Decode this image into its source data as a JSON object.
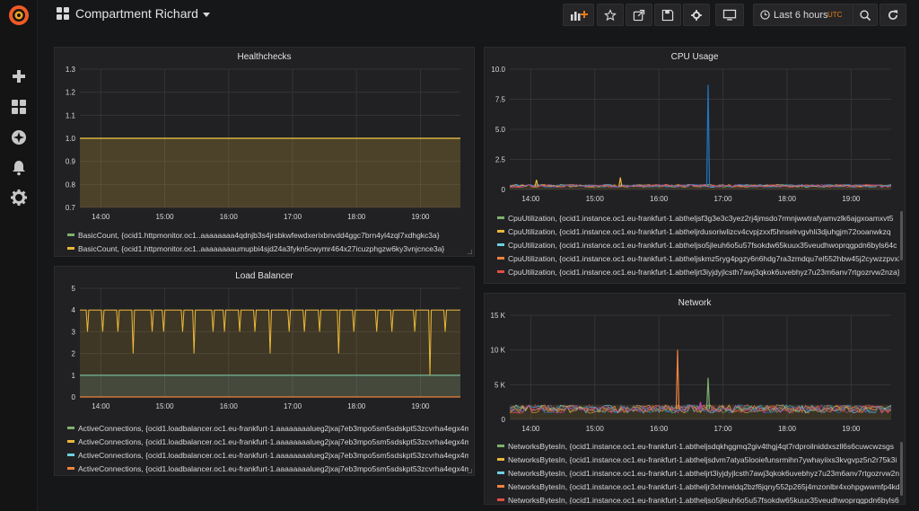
{
  "dashboard": {
    "title": "Compartment Richard"
  },
  "sidebar": {
    "items": [
      {
        "name": "create",
        "icon": "plus-icon"
      },
      {
        "name": "dashboards",
        "icon": "apps-grid-icon"
      },
      {
        "name": "explore",
        "icon": "compass-icon"
      },
      {
        "name": "alerting",
        "icon": "bell-icon"
      },
      {
        "name": "configuration",
        "icon": "gear-icon"
      }
    ]
  },
  "toolbar": {
    "time_range": "Last 6 hours",
    "timezone": "UTC",
    "buttons": [
      "add-panel-icon",
      "star-icon",
      "share-icon",
      "save-icon",
      "settings-gear-icon",
      "tv-mode-icon",
      "zoom-out-icon",
      "refresh-icon"
    ]
  },
  "colors": {
    "accent": "#eb7b18",
    "green": "#7eb26d",
    "yellow": "#eab839",
    "cyan": "#6ed0e0",
    "orange": "#ef843c",
    "red": "#e24d42",
    "blue": "#1f78c1",
    "purple": "#ba43a9"
  },
  "panels": {
    "healthchecks": {
      "title": "Healthchecks",
      "legend": [
        {
          "color": "#7eb26d",
          "text": "BasicCount, {ocid1.httpmonitor.oc1..aaaaaaaa4qdnjb3s4jrsbkwfewdxerixbnvdd4ggc7brn4yl4zql7xdhgkc3a}"
        },
        {
          "color": "#eab839",
          "text": "BasicCount, {ocid1.httpmonitor.oc1..aaaaaaaaumupbi4sjd24a3fykn5cwymr464x27icuzphgzw6ky3vnjcnce3a}"
        }
      ]
    },
    "load_balancer": {
      "title": "Load Balancer",
      "legend": [
        {
          "color": "#7eb26d",
          "text": "ActiveConnections, {ocid1.loadbalancer.oc1.eu-frankfurt-1.aaaaaaaalueg2jxaj7eb3mpo5sm5sdskpt53zcvrha4egx4m"
        },
        {
          "color": "#eab839",
          "text": "ActiveConnections, {ocid1.loadbalancer.oc1.eu-frankfurt-1.aaaaaaaalueg2jxaj7eb3mpo5sm5sdskpt53zcvrha4egx4m"
        },
        {
          "color": "#6ed0e0",
          "text": "ActiveConnections, {ocid1.loadbalancer.oc1.eu-frankfurt-1.aaaaaaaalueg2jxaj7eb3mpo5sm5sdskpt53zcvrha4egx4m"
        },
        {
          "color": "#ef843c",
          "text": "ActiveConnections, {ocid1.loadbalancer.oc1.eu-frankfurt-1.aaaaaaaalueg2jxaj7eb3mpo5sm5sdskpt53zcvrha4egx4m"
        }
      ]
    },
    "cpu_usage": {
      "title": "CPU Usage",
      "legend": [
        {
          "color": "#7eb26d",
          "text": "CpuUtilization, {ocid1.instance.oc1.eu-frankfurt-1.abtheljsf3g3e3c3yez2rj4jmsdo7rmnjwwtrafyamvzlk6ajgxoamxvt5"
        },
        {
          "color": "#eab839",
          "text": "CpuUtilization, {ocid1.instance.oc1.eu-frankfurt-1.abtheljrdusoriwlizcv4cvpjzxxf5hnselrvgvhli3djuhgjm72ooanwkzq"
        },
        {
          "color": "#6ed0e0",
          "text": "CpuUtilization, {ocid1.instance.oc1.eu-frankfurt-1.abtheljso5jleuh6o5u57fsokdw65kuux35veudhwoprqgpdn6byls64c"
        },
        {
          "color": "#ef843c",
          "text": "CpuUtilization, {ocid1.instance.oc1.eu-frankfurt-1.abtheljskmz5ryg4pgzy6n6hdg7ra3zmdqu7el552hbw45j2cywzzpvx3"
        },
        {
          "color": "#e24d42",
          "text": "CpuUtilization, {ocid1.instance.oc1.eu-frankfurt-1.abtheljrt3iyjdyjlcsth7awj3qkok6uvebhyz7u23m6anv7rtgozrvw2nza}"
        }
      ]
    },
    "network": {
      "title": "Network",
      "legend": [
        {
          "color": "#7eb26d",
          "text": "NetworksBytesIn, {ocid1.instance.oc1.eu-frankfurt-1.abtheljsdqkhggmq2giv4thgj4qt7rdproilniddxszll6s6cuwcwzsgs"
        },
        {
          "color": "#eab839",
          "text": "NetworksBytesIn, {ocid1.instance.oc1.eu-frankfurt-1.abtheljsdvm7atya5looiefunsrmihn7ywhayiixs3kvgvpz5n2r75k3i"
        },
        {
          "color": "#6ed0e0",
          "text": "NetworksBytesIn, {ocid1.instance.oc1.eu-frankfurt-1.abtheljrt3iyjdyjlcsth7awj3qkok6uvebhyz7u23m6anv7rtgozrvw2n"
        },
        {
          "color": "#ef843c",
          "text": "NetworksBytesIn, {ocid1.instance.oc1.eu-frankfurt-1.abtheljr3xhmeldq2bzf6jqny552p265j4mzonlbr4xohpgwwmfp4kd"
        },
        {
          "color": "#e24d42",
          "text": "NetworksBytesIn, {ocid1.instance.oc1.eu-frankfurt-1.abtheljso5jleuh6o5u57fsokdw65kuux35veudhwoprqgpdn6byls6"
        }
      ]
    }
  },
  "chart_data": [
    {
      "id": "healthchecks",
      "type": "line",
      "title": "Healthchecks",
      "x_ticks": [
        "14:00",
        "15:00",
        "16:00",
        "17:00",
        "18:00",
        "19:00"
      ],
      "y_ticks": [
        "0.7",
        "0.8",
        "0.9",
        "1.0",
        "1.1",
        "1.2",
        "1.3"
      ],
      "ylim": [
        0.7,
        1.3
      ],
      "series": [
        {
          "name": "BasicCount, {ocid1.httpmonitor.oc1..aaaaaaaa4qdnjb3s4jrsbkwfewdxerixbnvdd4ggc7brn4yl4zql7xdhgkc3a}",
          "color": "#7eb26d",
          "values": [
            1.0,
            1.0
          ]
        },
        {
          "name": "BasicCount, {ocid1.httpmonitor.oc1..aaaaaaaaumupbi4sjd24a3fykn5cwymr464x27icuzphgzw6ky3vnjcnce3a}",
          "color": "#eab839",
          "values": [
            1.0,
            1.0
          ]
        }
      ]
    },
    {
      "id": "load_balancer",
      "type": "line",
      "title": "Load Balancer",
      "x_ticks": [
        "14:00",
        "15:00",
        "16:00",
        "17:00",
        "18:00",
        "19:00"
      ],
      "y_ticks": [
        "0",
        "1",
        "2",
        "3",
        "4",
        "5"
      ],
      "ylim": [
        0,
        5
      ],
      "series": [
        {
          "name": "ActiveConnections (green)",
          "color": "#7eb26d",
          "constant": 1
        },
        {
          "name": "ActiveConnections (yellow)",
          "color": "#eab839",
          "base": 4,
          "dips": [
            [
              0.02,
              3
            ],
            [
              0.06,
              3
            ],
            [
              0.1,
              3
            ],
            [
              0.14,
              2
            ],
            [
              0.19,
              3
            ],
            [
              0.22,
              3
            ],
            [
              0.27,
              3
            ],
            [
              0.3,
              2
            ],
            [
              0.35,
              3
            ],
            [
              0.38,
              3
            ],
            [
              0.42,
              3
            ],
            [
              0.46,
              3
            ],
            [
              0.5,
              2
            ],
            [
              0.55,
              3
            ],
            [
              0.59,
              3
            ],
            [
              0.63,
              3
            ],
            [
              0.68,
              2
            ],
            [
              0.72,
              3
            ],
            [
              0.78,
              3
            ],
            [
              0.82,
              3
            ],
            [
              0.88,
              3
            ],
            [
              0.92,
              1
            ],
            [
              0.96,
              3
            ]
          ]
        },
        {
          "name": "ActiveConnections (cyan)",
          "color": "#6ed0e0",
          "constant": 1
        },
        {
          "name": "ActiveConnections (orange)",
          "color": "#ef843c",
          "constant": 0
        }
      ]
    },
    {
      "id": "cpu_usage",
      "type": "line",
      "title": "CPU Usage",
      "x_ticks": [
        "14:00",
        "15:00",
        "16:00",
        "17:00",
        "18:00",
        "19:00"
      ],
      "y_ticks": [
        "0",
        "2.5",
        "5.0",
        "7.5",
        "10.0"
      ],
      "ylim": [
        0,
        10
      ],
      "baseline": 0.3,
      "spikes": [
        {
          "x": 0.52,
          "y": 8.7,
          "color": "#1f78c1"
        },
        {
          "x": 0.29,
          "y": 1.0,
          "color": "#eab839"
        },
        {
          "x": 0.07,
          "y": 0.8,
          "color": "#eab839"
        }
      ]
    },
    {
      "id": "network",
      "type": "line",
      "title": "Network",
      "x_ticks": [
        "14:00",
        "15:00",
        "16:00",
        "17:00",
        "18:00",
        "19:00"
      ],
      "y_ticks": [
        "0",
        "5 K",
        "10 K",
        "15 K"
      ],
      "ylim": [
        0,
        15000
      ],
      "baseline": 1500,
      "spikes": [
        {
          "x": 0.44,
          "y": 10000,
          "color": "#ef843c"
        },
        {
          "x": 0.52,
          "y": 6000,
          "color": "#7eb26d"
        },
        {
          "x": 0.5,
          "y": 2500,
          "color": "#ba43a9"
        }
      ]
    }
  ]
}
